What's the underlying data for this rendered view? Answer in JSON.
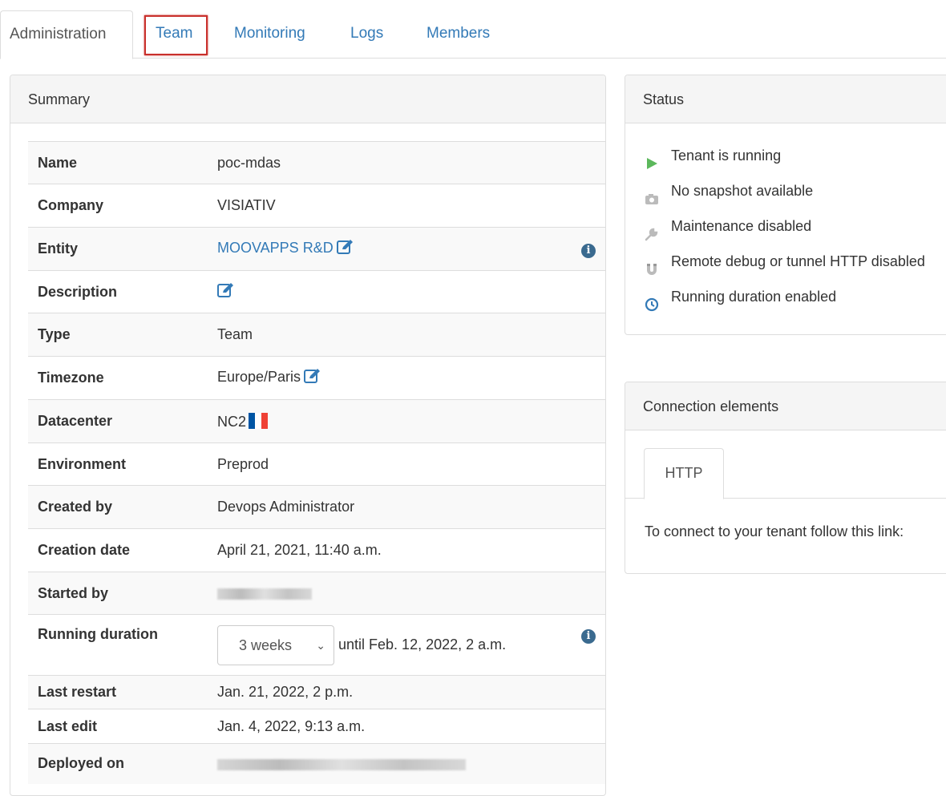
{
  "tabs": [
    "Administration",
    "Team",
    "Monitoring",
    "Logs",
    "Members"
  ],
  "summary": {
    "title": "Summary",
    "rows": {
      "name": {
        "label": "Name",
        "value": "poc-mdas"
      },
      "company": {
        "label": "Company",
        "value": "VISIATIV"
      },
      "entity": {
        "label": "Entity",
        "value": "MOOVAPPS R&D"
      },
      "description": {
        "label": "Description",
        "value": ""
      },
      "type": {
        "label": "Type",
        "value": "Team"
      },
      "timezone": {
        "label": "Timezone",
        "value": "Europe/Paris"
      },
      "datacenter": {
        "label": "Datacenter",
        "value": "NC2"
      },
      "environment": {
        "label": "Environment",
        "value": "Preprod"
      },
      "created_by": {
        "label": "Created by",
        "value": "Devops Administrator"
      },
      "creation_date": {
        "label": "Creation date",
        "value": "April 21, 2021, 11:40 a.m."
      },
      "started_by": {
        "label": "Started by"
      },
      "running_duration": {
        "label": "Running duration",
        "select_value": "3 weeks",
        "until": "until Feb. 12, 2022, 2 a.m."
      },
      "last_restart": {
        "label": "Last restart",
        "value": "Jan. 21, 2022, 2 p.m."
      },
      "last_edit": {
        "label": "Last edit",
        "value": "Jan. 4, 2022, 9:13 a.m."
      },
      "deployed_on": {
        "label": "Deployed on"
      }
    }
  },
  "status": {
    "title": "Status",
    "items": [
      {
        "icon": "play-icon",
        "text": "Tenant is running",
        "color": "#5cb85c"
      },
      {
        "icon": "camera-icon",
        "text": "No snapshot available",
        "color": "#bbbbbb"
      },
      {
        "icon": "wrench-icon",
        "text": "Maintenance disabled",
        "color": "#bbbbbb"
      },
      {
        "icon": "magnet-icon",
        "text": "Remote debug or tunnel HTTP disabled",
        "color": "#bbbbbb"
      },
      {
        "icon": "clock-icon",
        "text": "Running duration enabled",
        "color": "#337ab7"
      }
    ]
  },
  "connection": {
    "title": "Connection elements",
    "tab": "HTTP",
    "text": "To connect to your tenant follow this link:"
  },
  "colors": {
    "link": "#337ab7",
    "highlight": "#c9302c",
    "flag_blue": "#0055a4",
    "flag_red": "#ef4135"
  }
}
